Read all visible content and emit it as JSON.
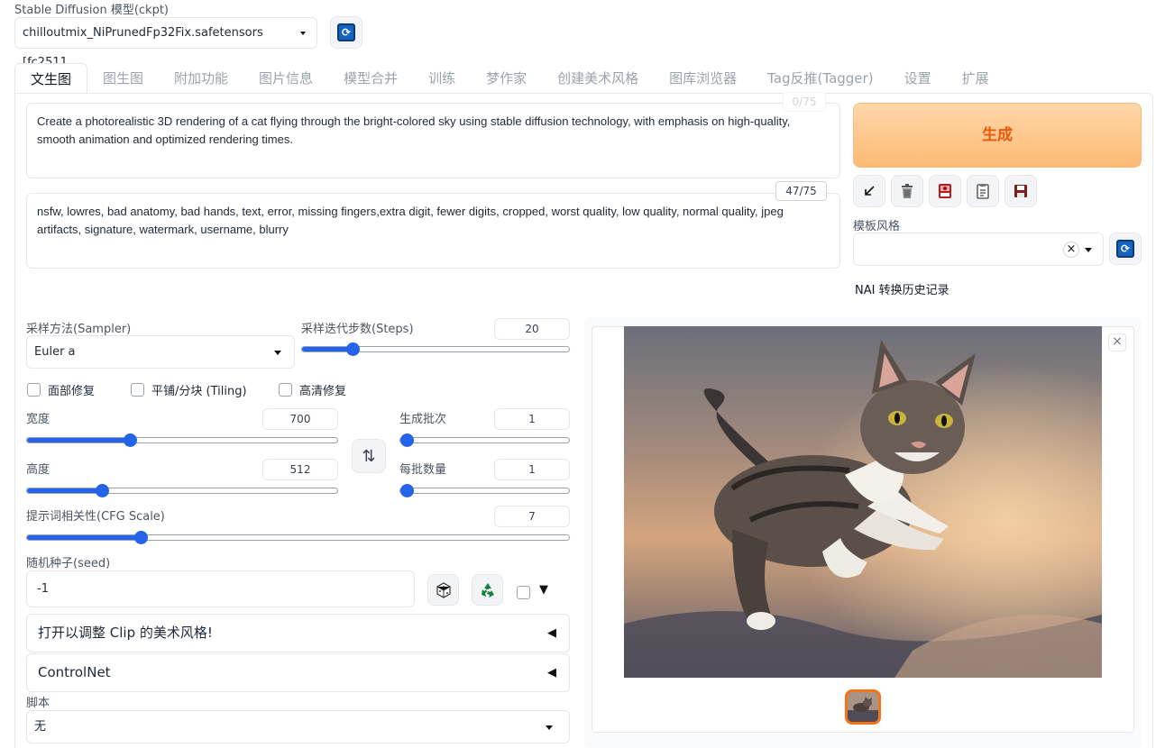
{
  "model": {
    "label": "Stable Diffusion 模型(ckpt)",
    "selected": "chilloutmix_NiPrunedFp32Fix.safetensors [fc2511"
  },
  "tabs": [
    {
      "label": "文生图",
      "active": true
    },
    {
      "label": "图生图"
    },
    {
      "label": "附加功能"
    },
    {
      "label": "图片信息"
    },
    {
      "label": "模型合并"
    },
    {
      "label": "训练"
    },
    {
      "label": "梦作家"
    },
    {
      "label": "创建美术风格"
    },
    {
      "label": "图库浏览器"
    },
    {
      "label": "Tag反推(Tagger)"
    },
    {
      "label": "设置"
    },
    {
      "label": "扩展"
    }
  ],
  "prompt": {
    "text": "Create a photorealistic 3D rendering of a cat flying through the bright-colored sky using stable diffusion technology, with emphasis on high-quality, smooth animation and optimized rendering times.",
    "counter": "0/75"
  },
  "negative_prompt": {
    "text": "nsfw, lowres, bad anatomy, bad hands, text, error, missing fingers,extra digit, fewer digits, cropped, worst quality, low quality, normal quality, jpeg artifacts, signature, watermark, username, blurry",
    "counter": "47/75"
  },
  "generate": {
    "label": "生成",
    "color": "#f97316"
  },
  "tool_icons": [
    "arrow-icon",
    "trash-icon",
    "red-card-icon",
    "clipboard-icon",
    "save-icon"
  ],
  "style": {
    "label": "模板风格",
    "clear": "×"
  },
  "nai_history": "NAI 转换历史记录",
  "sampler": {
    "label": "采样方法(Sampler)",
    "value": "Euler a"
  },
  "steps": {
    "label": "采样迭代步数(Steps)",
    "value": "20",
    "fraction": 0.19
  },
  "options": {
    "face_restore": "面部修复",
    "tiling": "平铺/分块 (Tiling)",
    "hires": "高清修复"
  },
  "width": {
    "label": "宽度",
    "value": "700",
    "fraction": 0.33
  },
  "height": {
    "label": "高度",
    "value": "512",
    "fraction": 0.24
  },
  "batch_count": {
    "label": "生成批次",
    "value": "1",
    "fraction": 0.0
  },
  "batch_size": {
    "label": "每批数量",
    "value": "1",
    "fraction": 0.0
  },
  "swap_icon": "⇅",
  "cfg": {
    "label": "提示词相关性(CFG Scale)",
    "value": "7",
    "fraction": 0.21
  },
  "seed": {
    "label": "随机种子(seed)",
    "value": "-1",
    "extra_arrow": "▼"
  },
  "accordions": [
    {
      "label": "打开以调整 Clip 的美术风格!",
      "arrow": "◀"
    },
    {
      "label": "ControlNet",
      "arrow": "◀"
    }
  ],
  "script": {
    "label": "脚本",
    "value": "无"
  },
  "output": {
    "close": "×",
    "image_subject": "cat leaping through sunset clouds"
  }
}
